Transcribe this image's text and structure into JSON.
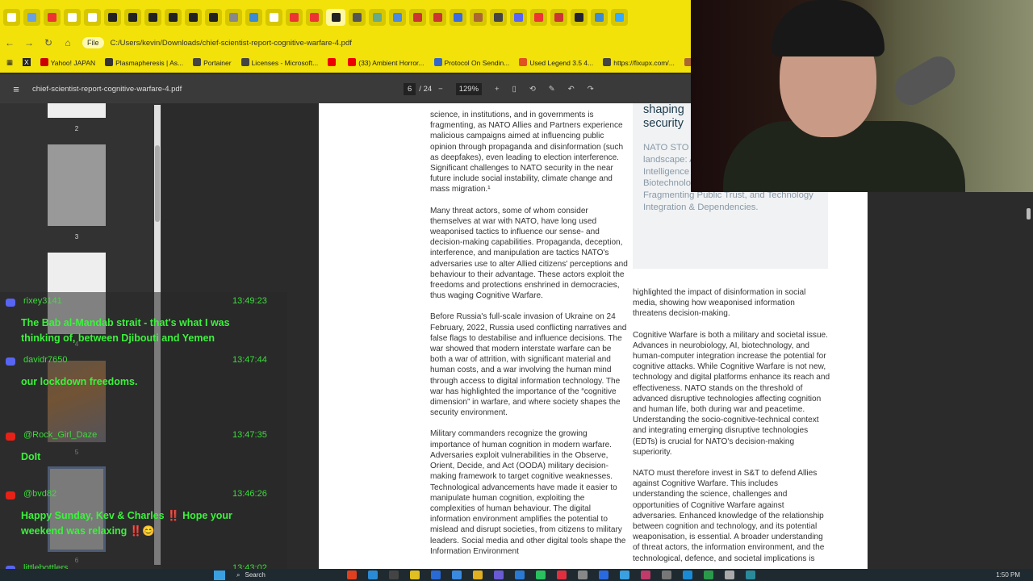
{
  "browser": {
    "address_chip": "File",
    "url": "C:/Users/kevin/Downloads/chief-scientist-report-cognitive-warfare-4.pdf",
    "bookmarks": [
      "Yahoo! JAPAN",
      "Plasmapheresis | As...",
      "Portainer",
      "Licenses - Microsoft...",
      "",
      "(33) Ambient Horror...",
      "Protocol On Sendin...",
      "Used Legend 3.5 4...",
      "https://fixupx.com/...",
      "Co"
    ]
  },
  "pdf": {
    "filename": "chief-scientist-report-cognitive-warfare-4.pdf",
    "page": "6",
    "total": "/ 24",
    "zoom": "129%",
    "thumb_labels": [
      "2",
      "3",
      "4",
      "5",
      "6"
    ],
    "left_col": [
      "science, in institutions, and in governments is fragmenting, as NATO Allies and Partners experience malicious campaigns aimed at influencing public opinion through propaganda and disinformation (such as deepfakes), even leading to election interference. Significant challenges to NATO security in the near future include social instability, climate change and mass migration.¹",
      "Many threat actors, some of whom consider themselves at war with NATO, have long used weaponised tactics to influence our sense- and decision-making capabilities. Propaganda, deception, interference, and manipulation are tactics NATO's adversaries use to alter Allied citizens' perceptions and behaviour to their advantage. These actors exploit the freedoms and protections enshrined in democracies, thus waging Cognitive Warfare.",
      "Before Russia's full-scale invasion of Ukraine on 24 February, 2022, Russia used conflicting narratives and false flags to destabilise and influence decisions. The war showed that modern interstate warfare can be both a war of attrition, with significant material and human costs, and a war involving the human mind through access to digital information technology. The war has highlighted the importance of the “cognitive dimension” in warfare, and where society shapes the security environment.",
      "Military commanders recognize the growing importance of human cognition in modern warfare. Adversaries exploit vulnerabilities in the Observe, Orient, Decide, and Act (OODA) military decision-making framework to target cognitive weaknesses. Technological advancements have made it easier to manipulate human cognition, exploiting the complexities of human behaviour. The digital information environment amplifies the potential to mislead and disrupt societies, from citizens to military leaders. Social media and other digital tools shape the Information Environment"
    ],
    "box_heading": "shaping security",
    "box_text": "NATO STO Trends that by S&T, sha landscape: Areas, Race for Artificial Intelligence (AI) and Quantum Superiority, Biotechnology Revolution, Resource Divide, Fragmenting Public Trust, and Technology Integration & Dependencies.",
    "right_col": [
      "highlighted the impact of disinformation in social media, showing how weaponised information threatens decision-making.",
      "Cognitive Warfare is both a military and societal issue. Advances in neurobiology, AI, biotechnology, and human-computer integration increase the potential for cognitive attacks. While Cognitive Warfare is not new, technology and digital platforms enhance its reach and effectiveness. NATO stands on the threshold of advanced disruptive technologies affecting cognition and human life, both during war and peacetime. Understanding the socio-cognitive-technical context and integrating emerging disruptive technologies (EDTs) is crucial for NATO's decision-making superiority.",
      "NATO must therefore invest in S&T to defend Allies against Cognitive Warfare. This includes understanding the science, challenges and opportunities of Cognitive Warfare against adversaries. Enhanced knowledge of the relationship between cognition and technology, and its potential weaponisation, is essential. A broader understanding of threat actors, the information environment, and the technological, defence, and societal implications is"
    ]
  },
  "chat": [
    {
      "platform": "discord",
      "user": "rixey3141",
      "time": "13:49:23",
      "text": "The Bab al-Mandab strait - that's what I was thinking of, between Djibouti and Yemen"
    },
    {
      "platform": "discord",
      "user": "davidr7650",
      "time": "13:47:44",
      "text": "our lockdown freedoms."
    },
    {
      "platform": "youtube",
      "user": "@Rock_Girl_Daze",
      "time": "13:47:35",
      "text": "DoIt"
    },
    {
      "platform": "youtube",
      "user": "@bvd82",
      "time": "13:46:26",
      "text": "Happy Sunday, Kev & Charles ‼️ Hope your weekend was relaxing ‼️😊"
    },
    {
      "platform": "discord",
      "user": "littlebottlers",
      "time": "13:43:02",
      "text": ""
    }
  ],
  "taskbar": {
    "search": "Search",
    "clock": "1:50 PM"
  },
  "colors": {
    "browser_theme": "#f2e20a",
    "chat_text": "#3cf23c",
    "discord": "#5865f2",
    "youtube": "#e62117"
  }
}
